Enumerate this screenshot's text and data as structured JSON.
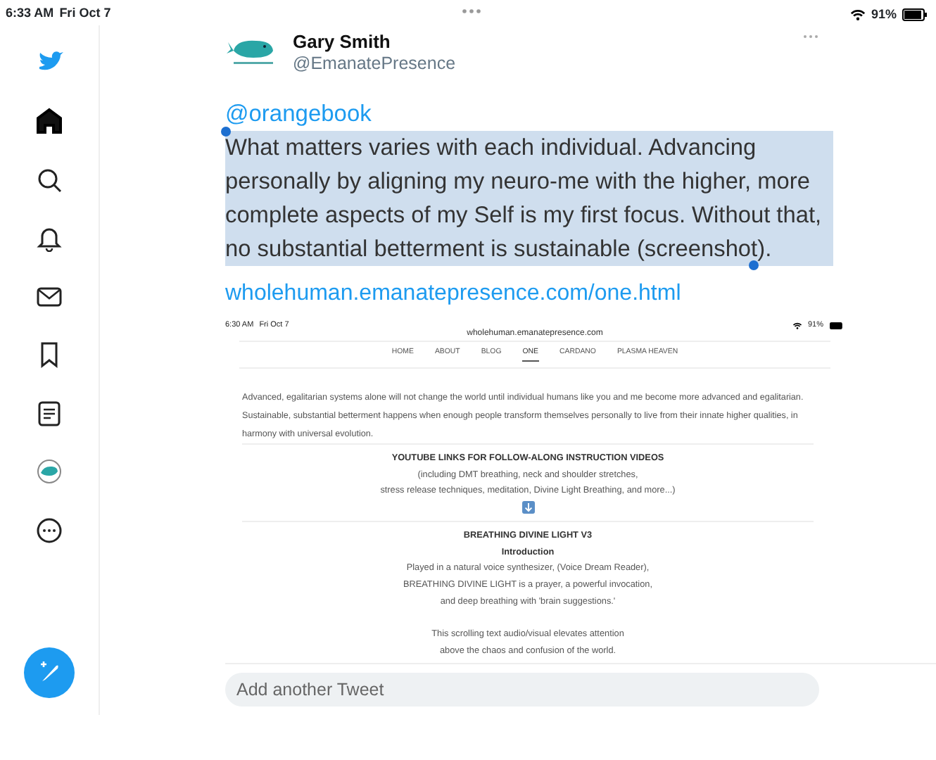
{
  "status_bar": {
    "time": "6:33 AM",
    "date": "Fri Oct 7",
    "battery": "91%"
  },
  "sidebar": {
    "items": [
      {
        "kind": "logo",
        "selected": false
      },
      {
        "kind": "home",
        "selected": true
      },
      {
        "kind": "search",
        "selected": false
      },
      {
        "kind": "bell",
        "selected": false
      },
      {
        "kind": "mail",
        "selected": false
      },
      {
        "kind": "bookmark",
        "selected": false
      },
      {
        "kind": "list",
        "selected": false
      },
      {
        "kind": "profile",
        "selected": false
      },
      {
        "kind": "more",
        "selected": false
      }
    ]
  },
  "tweet": {
    "name": "Gary Smith",
    "handle": "@EmanatePresence",
    "mention": "@orangebook",
    "body": "What matters varies with each individual. Advancing personally by aligning my neuro-me with the higher, more complete aspects of my Self is my first focus. Without that, no substantial betterment is sustainable (screenshot).",
    "body_selected": true,
    "link": "wholehuman.emanatepresence.com/one.html",
    "screenshot": {
      "time": "6:30 AM",
      "date": "Fri Oct 7",
      "url": "wholehuman.emanatepresence.com",
      "battery": "91%",
      "nav": [
        {
          "label": "HOME",
          "selected": false
        },
        {
          "label": "ABOUT",
          "selected": false
        },
        {
          "label": "BLOG",
          "selected": false
        },
        {
          "label": "ONE",
          "selected": true
        },
        {
          "label": "CARDANO",
          "selected": false
        },
        {
          "label": "PLASMA HEAVEN",
          "selected": false
        }
      ],
      "intro": "Advanced, egalitarian systems alone will not change the world until individual humans like you and me become more advanced and egalitarian. Sustainable, substantial betterment happens when enough people transform themselves personally to live from their innate higher qualities, in harmony with universal evolution.",
      "sections": [
        {
          "heading": "YOUTUBE LINKS FOR FOLLOW-ALONG INSTRUCTION VIDEOS",
          "paragraphs": [
            [
              "(including DMT breathing, neck and shoulder stretches,",
              "stress release techniques, meditation, Divine Light Breathing, and more...)"
            ]
          ],
          "arrow": true
        },
        {
          "heading": "BREATHING DIVINE LIGHT V3",
          "subheading": "Introduction",
          "paragraphs": [
            [
              "Played in a natural voice synthesizer, (Voice Dream Reader),",
              "BREATHING DIVINE LIGHT is a prayer, a powerful invocation,",
              "and deep breathing with 'brain suggestions.'"
            ],
            [
              "This scrolling text audio/visual elevates attention",
              "above the chaos and confusion of the world."
            ]
          ],
          "arrow": false
        }
      ]
    }
  },
  "reply": {
    "placeholder": "Add another Tweet"
  }
}
